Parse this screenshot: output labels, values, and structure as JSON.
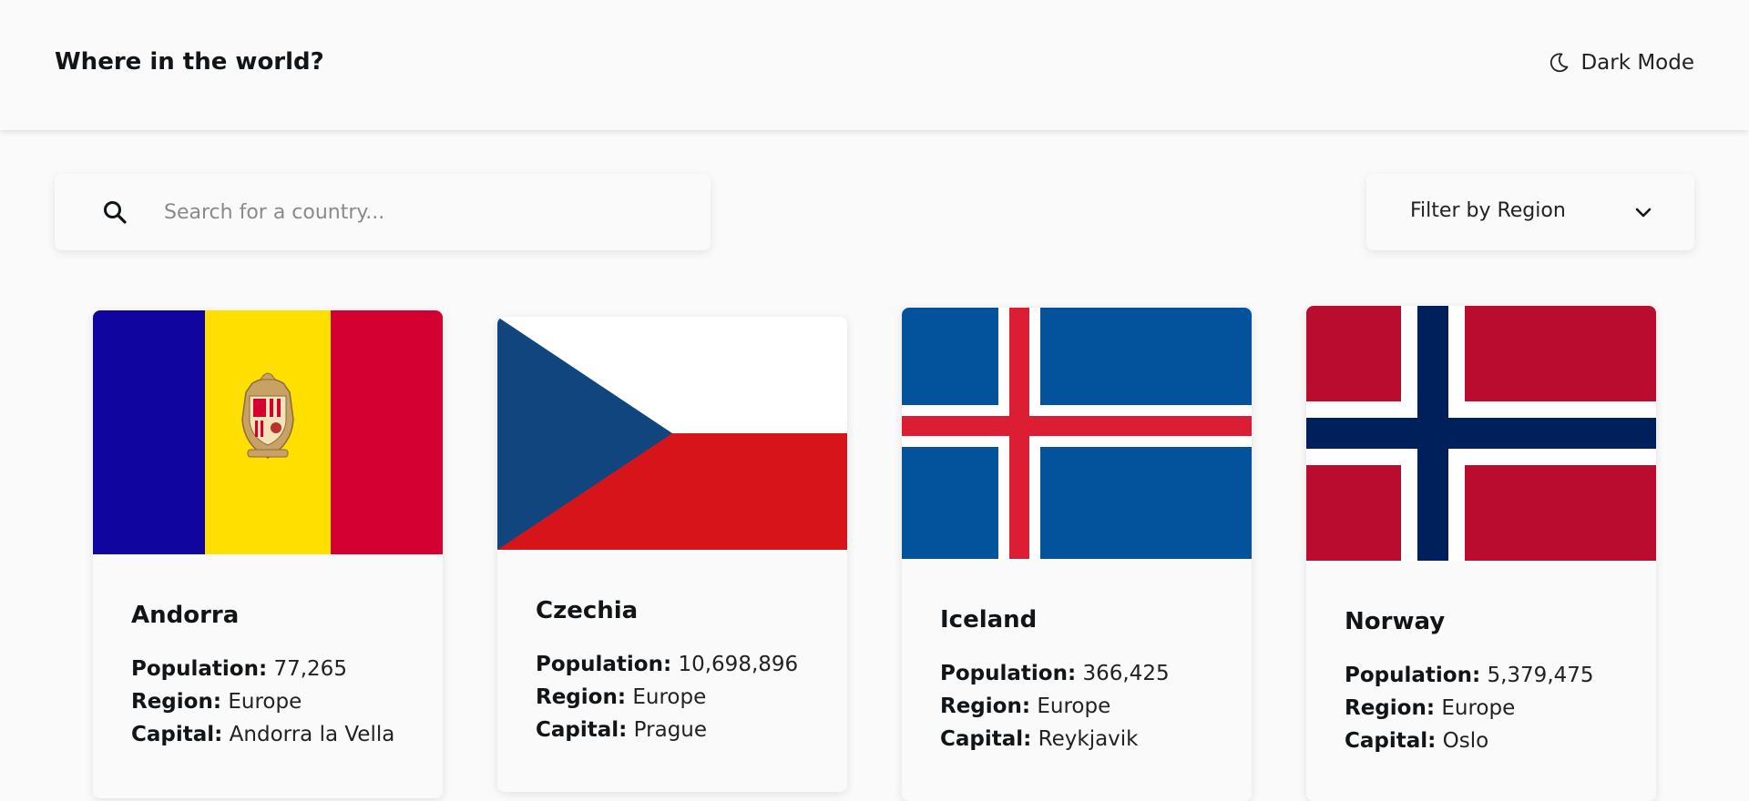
{
  "header": {
    "title": "Where in the world?",
    "dark_mode_label": "Dark Mode",
    "dark_mode_icon": "moon-icon"
  },
  "search": {
    "placeholder": "Search for a country...",
    "value": "",
    "icon": "search-icon"
  },
  "filter": {
    "label": "Filter by Region",
    "icon": "chevron-down-icon"
  },
  "labels": {
    "population": "Population:",
    "region": "Region:",
    "capital": "Capital:"
  },
  "countries": [
    {
      "name": "Andorra",
      "population": "77,265",
      "region": "Europe",
      "capital": "Andorra la Vella",
      "flag": "andorra-flag-icon"
    },
    {
      "name": "Czechia",
      "population": "10,698,896",
      "region": "Europe",
      "capital": "Prague",
      "flag": "czechia-flag-icon"
    },
    {
      "name": "Iceland",
      "population": "366,425",
      "region": "Europe",
      "capital": "Reykjavik",
      "flag": "iceland-flag-icon"
    },
    {
      "name": "Norway",
      "population": "5,379,475",
      "region": "Europe",
      "capital": "Oslo",
      "flag": "norway-flag-icon"
    }
  ],
  "colors": {
    "background": "#fafafa",
    "text": "#111517",
    "andorra_blue": "#10069f",
    "andorra_yellow": "#fedf00",
    "andorra_red": "#d50032",
    "czech_blue": "#11457e",
    "czech_red": "#d7141a",
    "iceland_blue": "#02529c",
    "iceland_red": "#dc1e35",
    "norway_red": "#ba0c2f",
    "norway_blue": "#00205b"
  }
}
